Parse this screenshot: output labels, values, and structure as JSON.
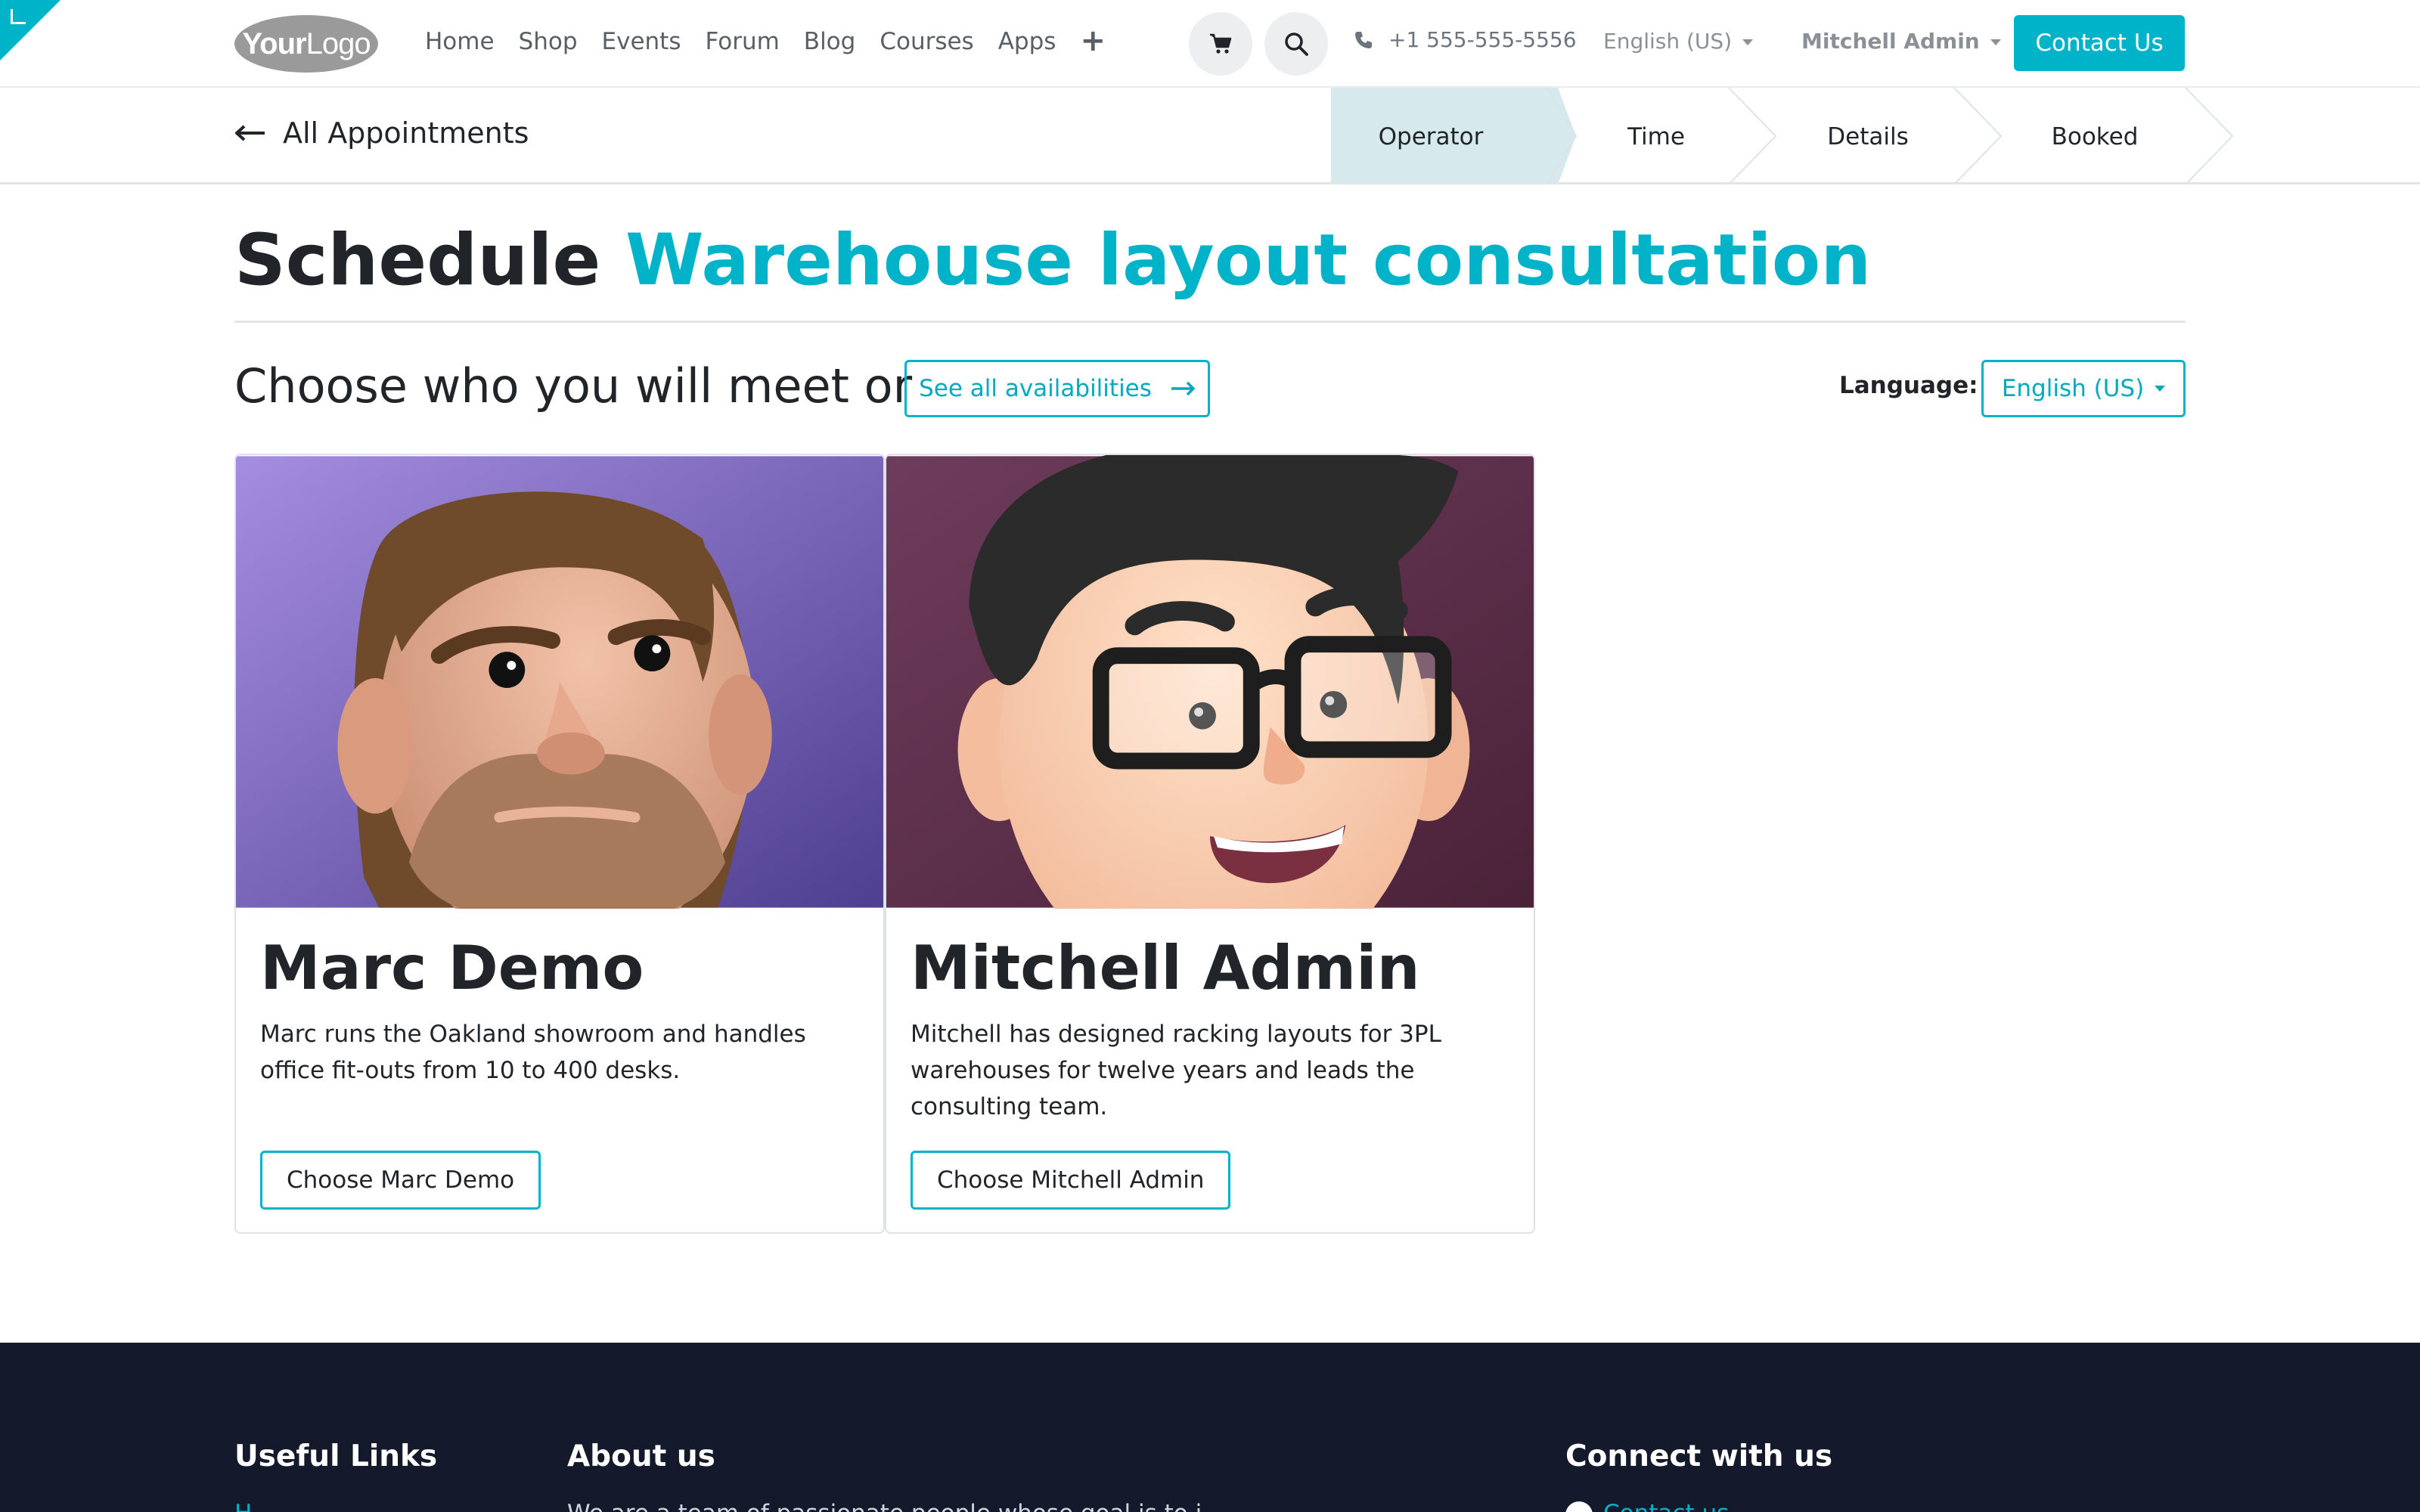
{
  "header": {
    "logo": {
      "bold": "Your",
      "light": "Logo"
    },
    "nav": [
      "Home",
      "Shop",
      "Events",
      "Forum",
      "Blog",
      "Courses",
      "Apps"
    ],
    "plus_icon": "plus-icon",
    "phone": "+1 555-555-5556",
    "language": "English (US)",
    "user": "Mitchell Admin",
    "contact_button": "Contact Us"
  },
  "breadcrumb": {
    "back_label": "All Appointments",
    "steps": [
      {
        "label": "Operator",
        "active": true
      },
      {
        "label": "Time",
        "active": false
      },
      {
        "label": "Details",
        "active": false
      },
      {
        "label": "Booked",
        "active": false
      }
    ]
  },
  "main": {
    "title_prefix": "Schedule",
    "title_accent": "Warehouse layout consultation",
    "subtitle": "Choose who you will meet or",
    "see_all_button": "See all availabilities",
    "language_label": "Language:",
    "language_value": "English (US)"
  },
  "operators": [
    {
      "name": "Marc Demo",
      "description": "Marc runs the Oakland showroom and handles office fit-outs from 10 to 400 desks.",
      "button": "Choose Marc Demo"
    },
    {
      "name": "Mitchell Admin",
      "description": "Mitchell has designed racking layouts for 3PL warehouses for twelve years and leads the consulting team.",
      "button": "Choose Mitchell Admin"
    }
  ],
  "footer": {
    "useful_links": "Useful Links",
    "useful_first": "H",
    "about_us": "About us",
    "about_text": "We are a team of passionate people whose goal is to i",
    "connect": "Connect with us",
    "connect_first": "Contact us"
  },
  "colors": {
    "accent": "#00b3c8",
    "active_step": "#d6e9ec",
    "footer_bg": "#141a2b"
  }
}
